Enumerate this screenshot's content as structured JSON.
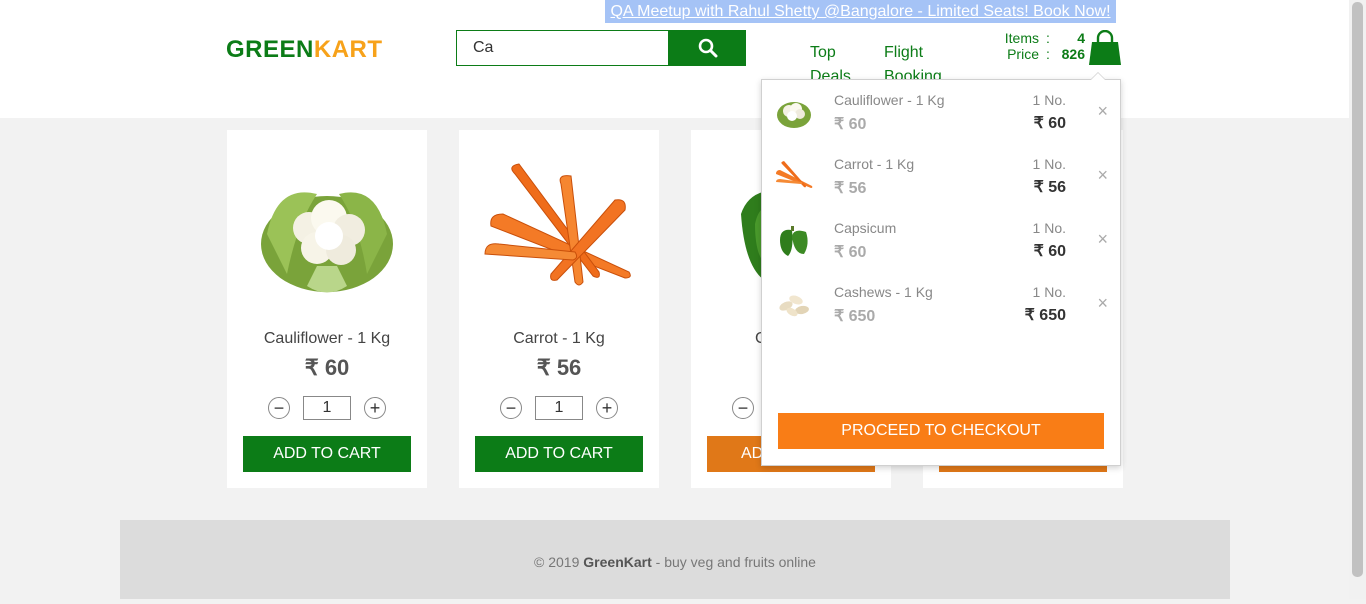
{
  "header": {
    "promo": "QA Meetup with Rahul Shetty @Bangalore - Limited Seats! Book Now!",
    "logo_part1": "GREEN",
    "logo_part2": "KART",
    "search_value": "Ca",
    "nav": [
      {
        "label": "Top Deals"
      },
      {
        "label": "Flight Booking"
      }
    ],
    "cart_summary": {
      "items_label": "Items",
      "items_value": "4",
      "price_label": "Price",
      "price_value": "826",
      "separator": ":"
    }
  },
  "products": [
    {
      "name": "Cauliflower - 1 Kg",
      "price": "₹ 60",
      "qty": "1",
      "button": "ADD TO CART",
      "icon": "cauliflower"
    },
    {
      "name": "Carrot - 1 Kg",
      "price": "₹ 56",
      "qty": "1",
      "button": "ADD TO CART",
      "icon": "carrot"
    },
    {
      "name": "C",
      "price": "",
      "qty": "",
      "button": "AD",
      "icon": "capsicum"
    },
    {
      "name": "",
      "price": "",
      "qty": "",
      "button": "",
      "icon": "cashews"
    }
  ],
  "cart_preview": {
    "items": [
      {
        "name": "Cauliflower - 1 Kg",
        "price": "₹ 60",
        "qty": "1 No.",
        "amount": "₹ 60",
        "icon": "cauliflower"
      },
      {
        "name": "Carrot - 1 Kg",
        "price": "₹ 56",
        "qty": "1 No.",
        "amount": "₹ 56",
        "icon": "carrot"
      },
      {
        "name": "Capsicum",
        "price": "₹ 60",
        "qty": "1 No.",
        "amount": "₹ 60",
        "icon": "capsicum"
      },
      {
        "name": "Cashews - 1 Kg",
        "price": "₹ 650",
        "qty": "1 No.",
        "amount": "₹ 650",
        "icon": "cashews"
      }
    ],
    "remove_symbol": "×",
    "checkout_label": "PROCEED TO CHECKOUT"
  },
  "footer": {
    "prefix": "© 2019 ",
    "brand": "GreenKart",
    "suffix": " - buy veg and fruits online"
  },
  "colors": {
    "brand_green": "#0c7c17",
    "brand_orange": "#f7a21a",
    "checkout_orange": "#f97d16",
    "promo_blue": "#a5c3f6"
  }
}
